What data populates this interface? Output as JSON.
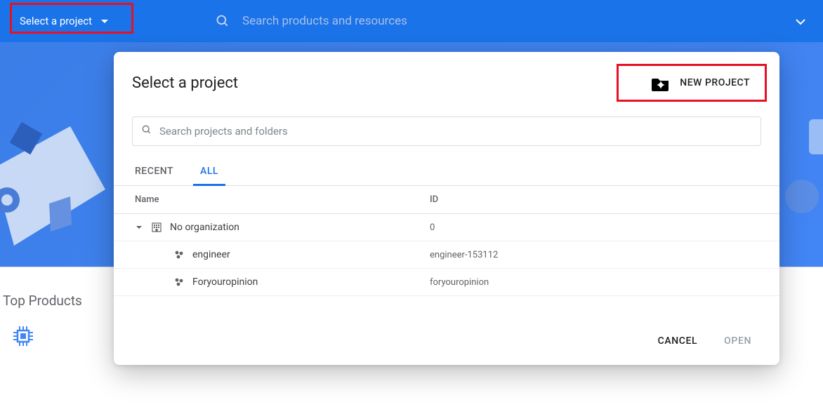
{
  "topbar": {
    "project_selector_label": "Select a project",
    "search_placeholder": "Search products and resources"
  },
  "bottom": {
    "top_products_label": "Top Products"
  },
  "modal": {
    "title": "Select a project",
    "new_project_label": "NEW PROJECT",
    "search_placeholder": "Search projects and folders",
    "tabs": {
      "recent": "RECENT",
      "all": "ALL"
    },
    "columns": {
      "name": "Name",
      "id": "ID"
    },
    "rows": [
      {
        "type": "org",
        "name": "No organization",
        "id": "0"
      },
      {
        "type": "project",
        "name": "engineer",
        "id": "engineer-153112"
      },
      {
        "type": "project",
        "name": "Foryouropinion",
        "id": "foryouropinion"
      }
    ],
    "footer": {
      "cancel": "CANCEL",
      "open": "OPEN"
    }
  }
}
